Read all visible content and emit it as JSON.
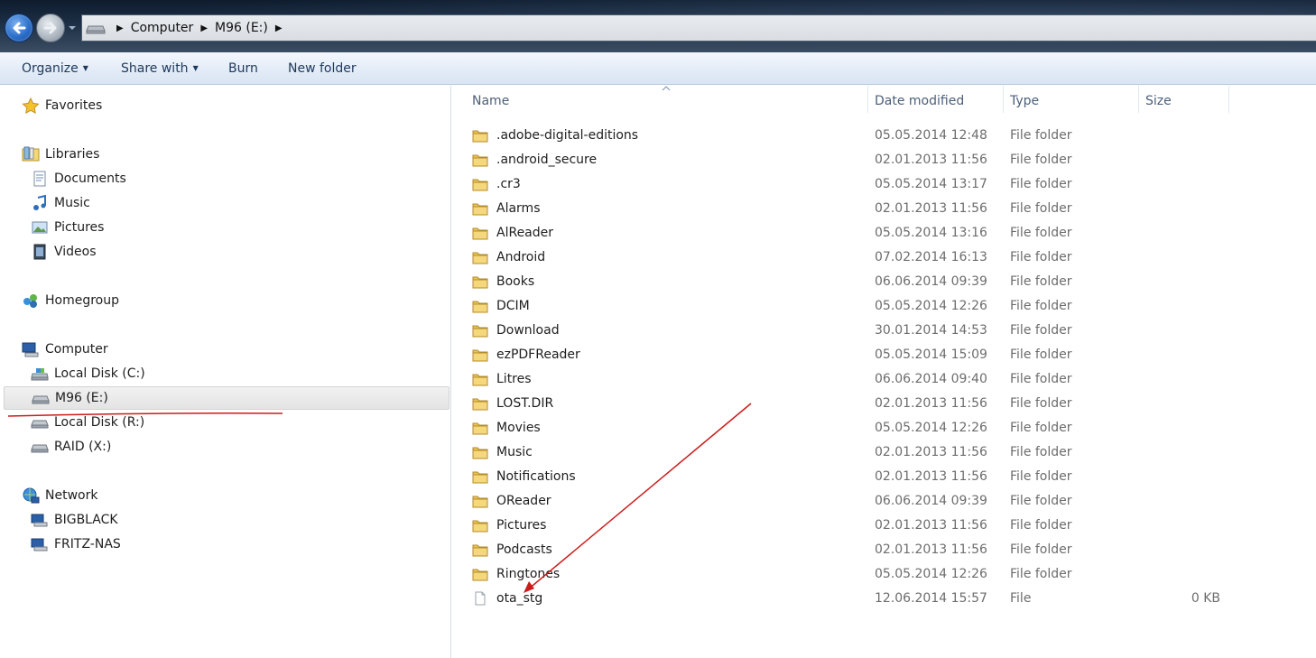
{
  "address": {
    "crumbs": [
      "Computer",
      "M96 (E:)"
    ]
  },
  "toolbar": {
    "organize": "Organize",
    "share_with": "Share with",
    "burn": "Burn",
    "new_folder": "New folder"
  },
  "nav": {
    "favorites": "Favorites",
    "libraries": "Libraries",
    "documents": "Documents",
    "music": "Music",
    "pictures": "Pictures",
    "videos": "Videos",
    "homegroup": "Homegroup",
    "computer": "Computer",
    "local_disk_c": "Local Disk (C:)",
    "m96": "M96 (E:)",
    "local_disk_r": "Local Disk (R:)",
    "raid": "RAID (X:)",
    "network": "Network",
    "bigblack": "BIGBLACK",
    "fritz_nas": "FRITZ-NAS"
  },
  "columns": {
    "name": "Name",
    "date": "Date modified",
    "type": "Type",
    "size": "Size"
  },
  "files": [
    {
      "name": ".adobe-digital-editions",
      "date": "05.05.2014 12:48",
      "type": "File folder",
      "size": "",
      "kind": "folder"
    },
    {
      "name": ".android_secure",
      "date": "02.01.2013 11:56",
      "type": "File folder",
      "size": "",
      "kind": "folder"
    },
    {
      "name": ".cr3",
      "date": "05.05.2014 13:17",
      "type": "File folder",
      "size": "",
      "kind": "folder"
    },
    {
      "name": "Alarms",
      "date": "02.01.2013 11:56",
      "type": "File folder",
      "size": "",
      "kind": "folder"
    },
    {
      "name": "AlReader",
      "date": "05.05.2014 13:16",
      "type": "File folder",
      "size": "",
      "kind": "folder"
    },
    {
      "name": "Android",
      "date": "07.02.2014 16:13",
      "type": "File folder",
      "size": "",
      "kind": "folder"
    },
    {
      "name": "Books",
      "date": "06.06.2014 09:39",
      "type": "File folder",
      "size": "",
      "kind": "folder"
    },
    {
      "name": "DCIM",
      "date": "05.05.2014 12:26",
      "type": "File folder",
      "size": "",
      "kind": "folder"
    },
    {
      "name": "Download",
      "date": "30.01.2014 14:53",
      "type": "File folder",
      "size": "",
      "kind": "folder"
    },
    {
      "name": "ezPDFReader",
      "date": "05.05.2014 15:09",
      "type": "File folder",
      "size": "",
      "kind": "folder"
    },
    {
      "name": "Litres",
      "date": "06.06.2014 09:40",
      "type": "File folder",
      "size": "",
      "kind": "folder"
    },
    {
      "name": "LOST.DIR",
      "date": "02.01.2013 11:56",
      "type": "File folder",
      "size": "",
      "kind": "folder"
    },
    {
      "name": "Movies",
      "date": "05.05.2014 12:26",
      "type": "File folder",
      "size": "",
      "kind": "folder"
    },
    {
      "name": "Music",
      "date": "02.01.2013 11:56",
      "type": "File folder",
      "size": "",
      "kind": "folder"
    },
    {
      "name": "Notifications",
      "date": "02.01.2013 11:56",
      "type": "File folder",
      "size": "",
      "kind": "folder"
    },
    {
      "name": "OReader",
      "date": "06.06.2014 09:39",
      "type": "File folder",
      "size": "",
      "kind": "folder"
    },
    {
      "name": "Pictures",
      "date": "02.01.2013 11:56",
      "type": "File folder",
      "size": "",
      "kind": "folder"
    },
    {
      "name": "Podcasts",
      "date": "02.01.2013 11:56",
      "type": "File folder",
      "size": "",
      "kind": "folder"
    },
    {
      "name": "Ringtones",
      "date": "05.05.2014 12:26",
      "type": "File folder",
      "size": "",
      "kind": "folder"
    },
    {
      "name": "ota_stg",
      "date": "12.06.2014 15:57",
      "type": "File",
      "size": "0 KB",
      "kind": "file"
    }
  ],
  "annotation_color": "#cc1b1b"
}
